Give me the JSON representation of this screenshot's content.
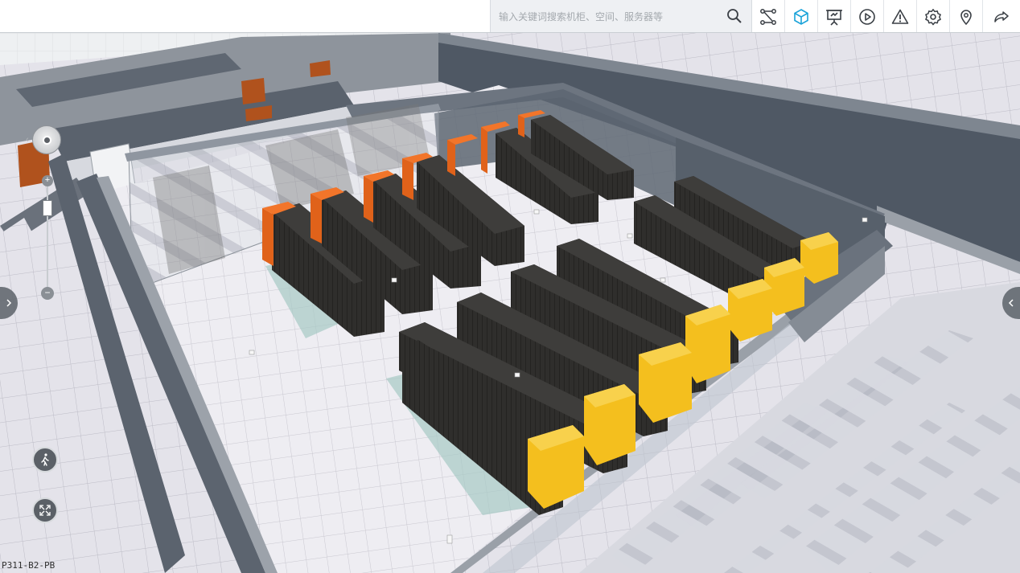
{
  "search": {
    "placeholder": "输入关键词搜索机柜、空间、服务器等"
  },
  "toolbar": {
    "tools": [
      {
        "icon": "search-icon"
      },
      {
        "icon": "topology-icon"
      },
      {
        "icon": "3d-cube-icon",
        "active": true
      },
      {
        "icon": "presentation-icon"
      },
      {
        "icon": "play-icon"
      },
      {
        "icon": "warning-icon"
      },
      {
        "icon": "gear-icon"
      },
      {
        "icon": "location-pin-icon"
      },
      {
        "icon": "share-icon"
      }
    ]
  },
  "navigation": {
    "zoom_in": "+",
    "zoom_out": "−",
    "icons": [
      "compass-icon",
      "walk-icon",
      "fullscreen-icon",
      "chevron-right-icon",
      "chevron-left-icon"
    ]
  },
  "scene": {
    "location_label": "P311-B2-PB"
  },
  "colors": {
    "active_tool": "#1aa3d9",
    "rack_body": "#2e2d2b",
    "rack_end_orange": "#ef6b1c",
    "rack_end_yellow": "#f2bd1a",
    "wall": "#56606c",
    "floor": "#eceaf0"
  }
}
